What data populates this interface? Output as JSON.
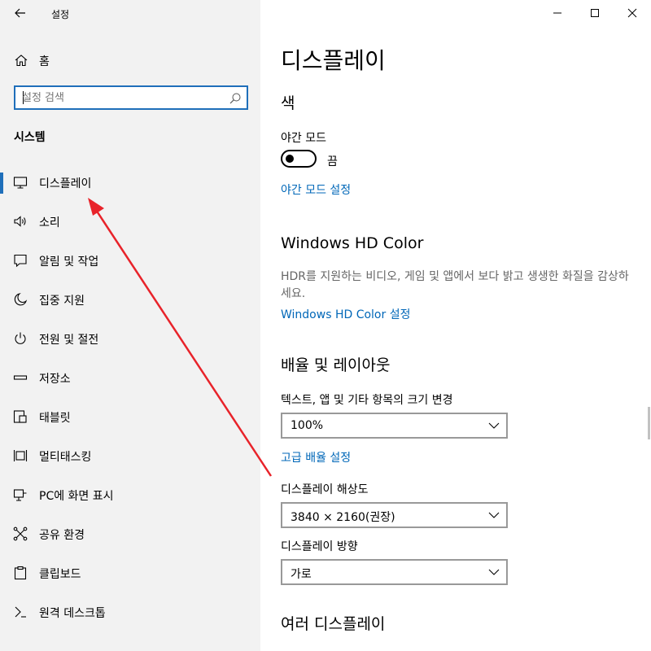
{
  "window": {
    "title": "설정",
    "controls": {
      "minimize": "minimize-icon",
      "maximize": "maximize-icon",
      "close": "close-icon"
    }
  },
  "sidebar": {
    "home_label": "홈",
    "search_placeholder": "설정 검색",
    "section_label": "시스템",
    "items": [
      {
        "label": "디스플레이",
        "icon": "monitor-icon",
        "active": true
      },
      {
        "label": "소리",
        "icon": "speaker-icon"
      },
      {
        "label": "알림 및 작업",
        "icon": "notification-icon"
      },
      {
        "label": "집중 지원",
        "icon": "moon-icon"
      },
      {
        "label": "전원 및 절전",
        "icon": "power-icon"
      },
      {
        "label": "저장소",
        "icon": "storage-icon"
      },
      {
        "label": "태블릿",
        "icon": "tablet-icon"
      },
      {
        "label": "멀티태스킹",
        "icon": "multitasking-icon"
      },
      {
        "label": "PC에 화면 표시",
        "icon": "project-icon"
      },
      {
        "label": "공유 환경",
        "icon": "shared-experiences-icon"
      },
      {
        "label": "클립보드",
        "icon": "clipboard-icon"
      },
      {
        "label": "원격 데스크톱",
        "icon": "remote-desktop-icon"
      }
    ]
  },
  "main": {
    "title": "디스플레이",
    "color_section": {
      "heading": "색",
      "night_light_label": "야간 모드",
      "toggle_state": "끔",
      "night_light_link": "야간 모드 설정"
    },
    "hdr_section": {
      "heading": "Windows HD Color",
      "description": "HDR를 지원하는 비디오, 게임 및 앱에서 보다 밝고 생생한 화질을 감상하세요.",
      "link": "Windows HD Color 설정"
    },
    "layout_section": {
      "heading": "배율 및 레이아웃",
      "scale_label": "텍스트, 앱 및 기타 항목의 크기 변경",
      "scale_value": "100%",
      "advanced_link": "고급 배율 설정",
      "resolution_label": "디스플레이 해상도",
      "resolution_value": "3840 × 2160(권장)",
      "orientation_label": "디스플레이 방향",
      "orientation_value": "가로"
    },
    "multi_display_section": {
      "heading": "여러 디스플레이"
    }
  },
  "colors": {
    "accent": "#0067b8",
    "annotation_arrow": "#e8232a",
    "sidebar_bg": "#f2f2f2"
  }
}
